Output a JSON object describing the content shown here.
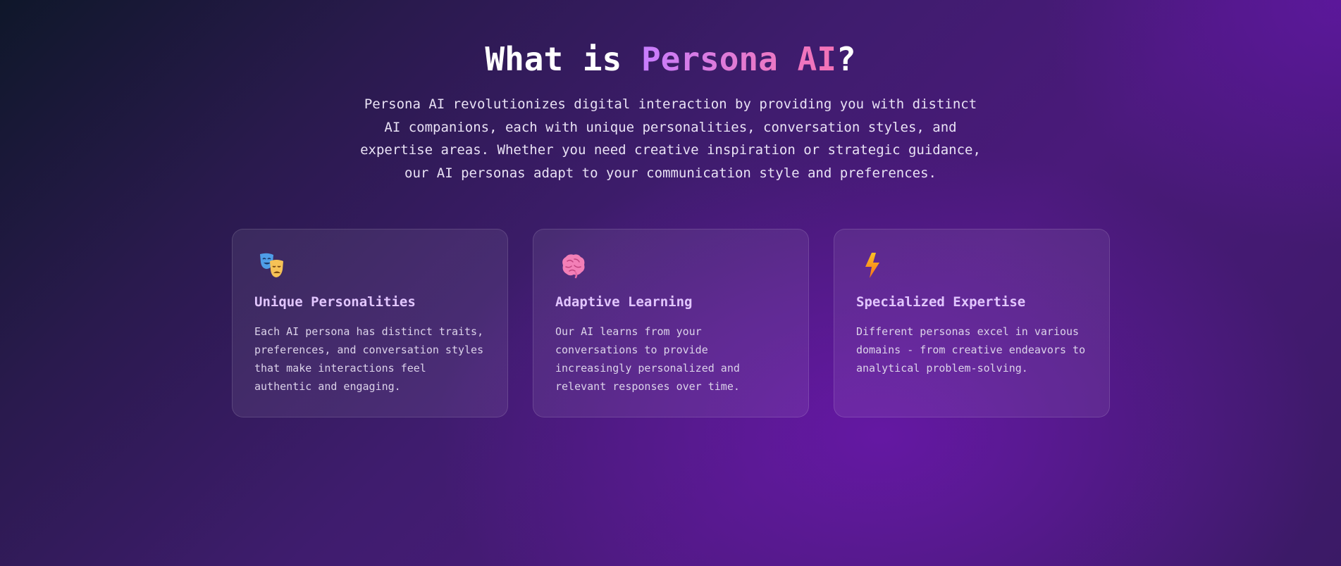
{
  "hero": {
    "title_prefix": "What is ",
    "title_accent": "Persona AI",
    "title_suffix": "?",
    "description": "Persona AI revolutionizes digital interaction by providing you with distinct AI companions, each with unique personalities, conversation styles, and expertise areas. Whether you need creative inspiration or strategic guidance, our AI personas adapt to your communication style and preferences."
  },
  "features": [
    {
      "icon": "theater-masks-icon",
      "title": "Unique Personalities",
      "text": "Each AI persona has distinct traits, preferences, and conversation styles that make interactions feel authentic and engaging."
    },
    {
      "icon": "brain-icon",
      "title": "Adaptive Learning",
      "text": "Our AI learns from your conversations to provide increasingly personalized and relevant responses over time."
    },
    {
      "icon": "lightning-bolt-icon",
      "title": "Specialized Expertise",
      "text": "Different personas excel in various domains - from creative endeavors to analytical problem-solving."
    }
  ],
  "colors": {
    "title_accent_start": "#c77dff",
    "title_accent_end": "#f472b6",
    "card_title": "#e2c6ff",
    "background_deep": "#0f172a",
    "background_purple": "#5b1a8c"
  }
}
